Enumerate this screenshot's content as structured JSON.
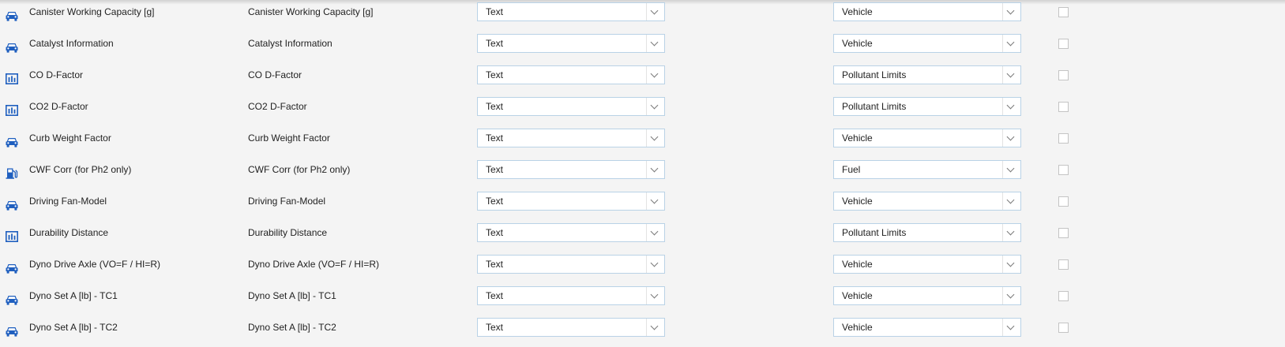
{
  "rows": [
    {
      "icon": "car-icon",
      "name": "Canister Working Capacity [g]",
      "label": "Canister Working Capacity [g]",
      "type": "Text",
      "category": "Vehicle",
      "checked": false
    },
    {
      "icon": "car-icon",
      "name": "Catalyst Information",
      "label": "Catalyst Information",
      "type": "Text",
      "category": "Vehicle",
      "checked": false
    },
    {
      "icon": "chart-icon",
      "name": "CO D-Factor",
      "label": "CO D-Factor",
      "type": "Text",
      "category": "Pollutant Limits",
      "checked": false
    },
    {
      "icon": "chart-icon",
      "name": "CO2 D-Factor",
      "label": "CO2 D-Factor",
      "type": "Text",
      "category": "Pollutant Limits",
      "checked": false
    },
    {
      "icon": "car-icon",
      "name": "Curb Weight Factor",
      "label": "Curb Weight Factor",
      "type": "Text",
      "category": "Vehicle",
      "checked": false
    },
    {
      "icon": "fuel-icon",
      "name": "CWF Corr (for Ph2 only)",
      "label": "CWF Corr (for Ph2 only)",
      "type": "Text",
      "category": "Fuel",
      "checked": false
    },
    {
      "icon": "car-icon",
      "name": "Driving Fan-Model",
      "label": "Driving Fan-Model",
      "type": "Text",
      "category": "Vehicle",
      "checked": false
    },
    {
      "icon": "chart-icon",
      "name": "Durability Distance",
      "label": "Durability Distance",
      "type": "Text",
      "category": "Pollutant Limits",
      "checked": false
    },
    {
      "icon": "car-icon",
      "name": "Dyno Drive Axle (VO=F / HI=R)",
      "label": "Dyno Drive Axle (VO=F / HI=R)",
      "type": "Text",
      "category": "Vehicle",
      "checked": false
    },
    {
      "icon": "car-icon",
      "name": "Dyno Set A [lb] - TC1",
      "label": "Dyno Set A [lb] - TC1",
      "type": "Text",
      "category": "Vehicle",
      "checked": false
    },
    {
      "icon": "car-icon",
      "name": "Dyno Set A [lb] - TC2",
      "label": "Dyno Set A [lb] - TC2",
      "type": "Text",
      "category": "Vehicle",
      "checked": false
    }
  ],
  "colors": {
    "icon": "#1f5fbf",
    "select_border": "#b9d2e6",
    "background": "#f4f4f4"
  }
}
